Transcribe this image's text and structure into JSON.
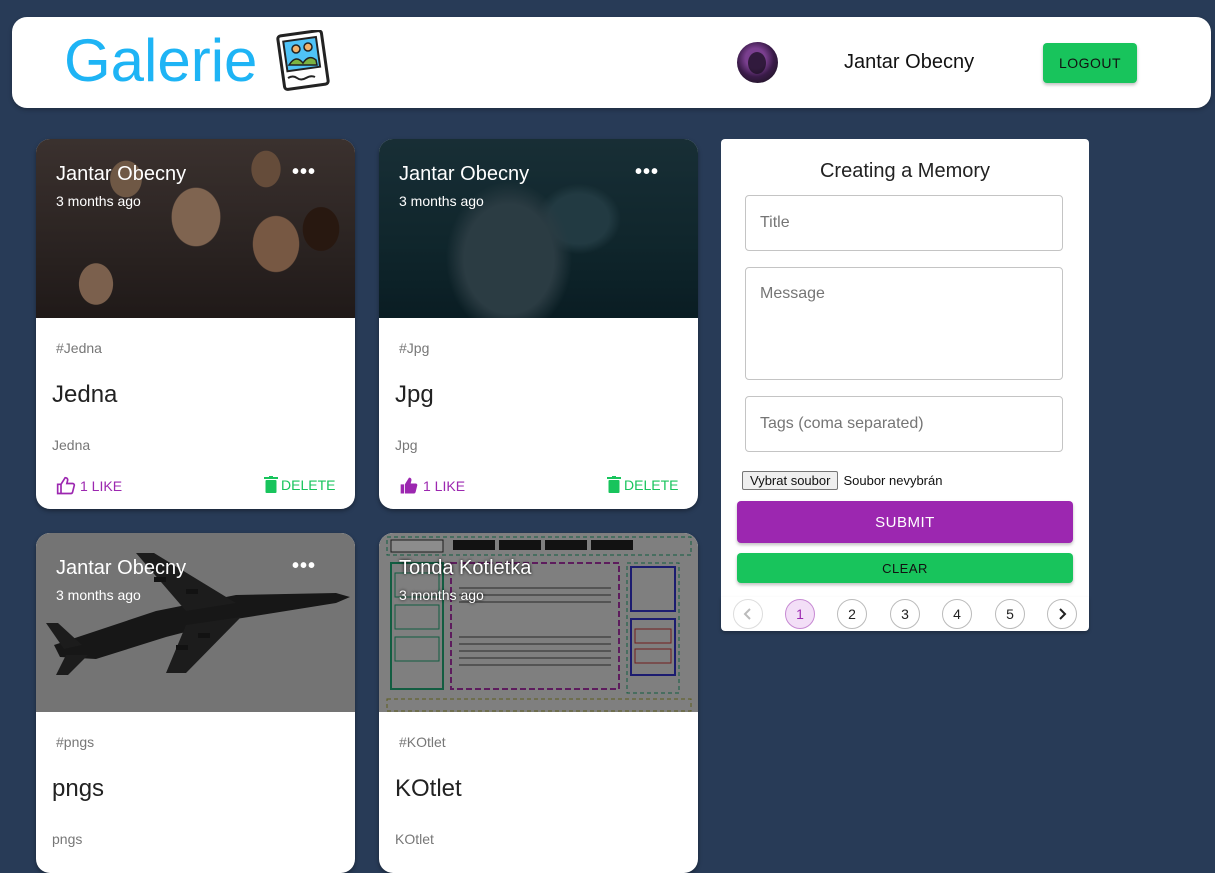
{
  "header": {
    "brand": "Galerie",
    "username": "Jantar Obecny",
    "logout_label": "LOGOUT"
  },
  "posts": [
    {
      "author": "Jantar Obecny",
      "time": "3 months ago",
      "more": "•••",
      "tags": "#Jedna",
      "title": "Jedna",
      "message": "Jedna",
      "like_label": "1 LIKE",
      "delete_label": "DELETE",
      "image": "group-selfie-photo"
    },
    {
      "author": "Jantar Obecny",
      "time": "3 months ago",
      "more": "•••",
      "tags": "#Jpg",
      "title": "Jpg",
      "message": "Jpg",
      "like_label": "1 LIKE",
      "delete_label": "DELETE",
      "image": "underwater-photo"
    },
    {
      "author": "Jantar Obecny",
      "time": "3 months ago",
      "more": "•••",
      "tags": "#pngs",
      "title": "pngs",
      "message": "pngs",
      "like_label": "",
      "delete_label": "",
      "image": "airplane-photo"
    },
    {
      "author": "Tonda Kotletka",
      "time": "3 months ago",
      "more": "",
      "tags": "#KOtlet",
      "title": "KOtlet",
      "message": "KOtlet",
      "like_label": "",
      "delete_label": "",
      "image": "web-layout-sketch"
    }
  ],
  "form": {
    "title": "Creating a Memory",
    "title_placeholder": "Title",
    "message_placeholder": "Message",
    "tags_placeholder": "Tags (coma separated)",
    "file_button": "Vybrat soubor",
    "file_status": "Soubor nevybrán",
    "submit_label": "SUBMIT",
    "clear_label": "CLEAR"
  },
  "pagination": {
    "pages": [
      "1",
      "2",
      "3",
      "4",
      "5"
    ],
    "current": 1
  },
  "colors": {
    "background": "#283b57",
    "brand": "#1eb4f5",
    "primary": "#9c27b0",
    "secondary": "#18c45c"
  }
}
